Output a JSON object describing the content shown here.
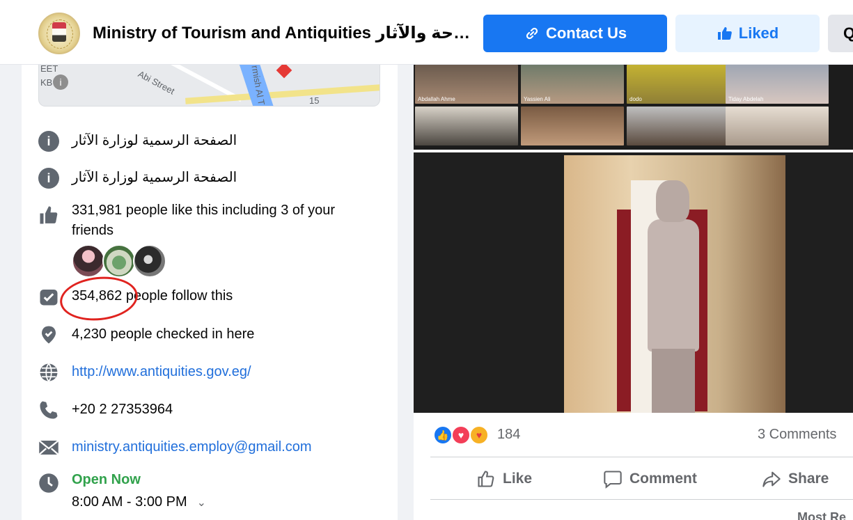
{
  "header": {
    "page_title": "Ministry of Tourism and Antiquities وزارة السياحة والآثار",
    "contact_label": "Contact Us",
    "liked_label": "Liked",
    "more_label": "Q"
  },
  "map": {
    "street_label": "Abi Street",
    "label_left": "EET",
    "label_left2": "KB",
    "label_right": "rmish Al T",
    "label_num": "15"
  },
  "about": {
    "desc1": "الصفحة الرسمية لوزارة الآثار",
    "desc2": "الصفحة الرسمية لوزارة الآثار",
    "likes": "331,981 people like this including 3 of your friends",
    "follow_count": "354,862",
    "follow_text": " people follow this",
    "checkins": "4,230 people checked in here",
    "website": "http://www.antiquities.gov.eg/",
    "phone": "+20 2 27353964",
    "email": "ministry.antiquities.employ@gmail.com",
    "open_status": "Open Now",
    "hours": "8:00 AM - 3:00 PM"
  },
  "post": {
    "participants": [
      "Abdallah Ahme",
      "Yassien Ali",
      "dodo",
      "Tiday Abdelah",
      "",
      "",
      "",
      ""
    ],
    "reaction_count": "184",
    "comments": "3 Comments",
    "like_label": "Like",
    "comment_label": "Comment",
    "share_label": "Share",
    "most_relevant": "Most Re"
  }
}
